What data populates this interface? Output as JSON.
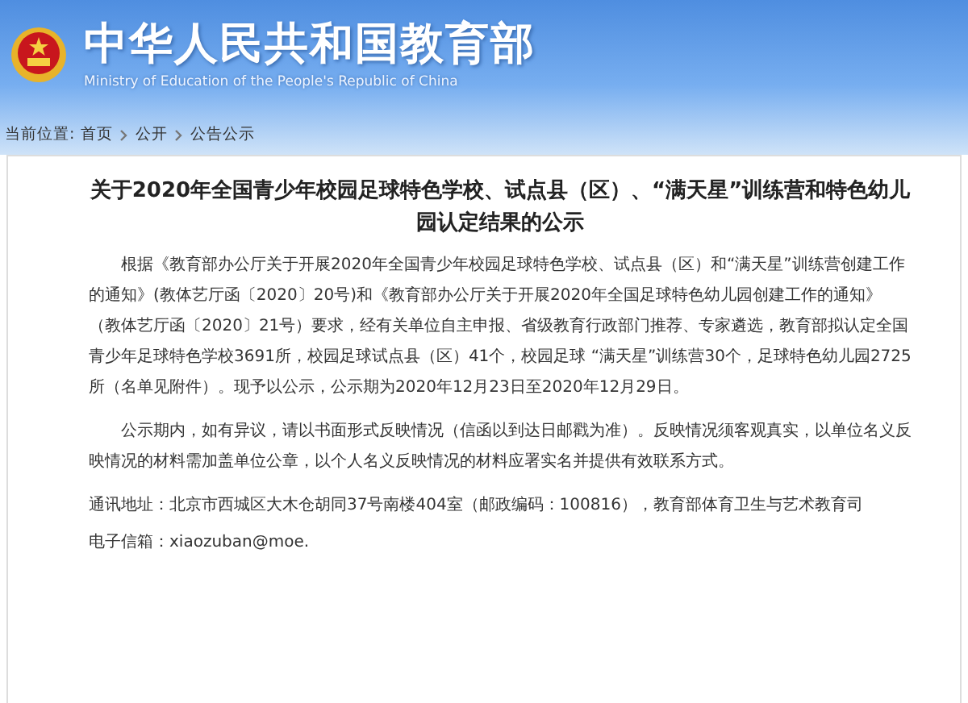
{
  "header": {
    "title": "中华人民共和国教育部",
    "subtitle": "Ministry of Education of the People's Republic of China"
  },
  "breadcrumb": {
    "label": "当前位置:",
    "items": [
      "首页",
      "公开",
      "公告公示"
    ]
  },
  "article": {
    "title": "关于2020年全国青少年校园足球特色学校、试点县（区）、“满天星”训练营和特色幼儿园认定结果的公示",
    "paragraphs": [
      "根据《教育部办公厅关于开展2020年全国青少年校园足球特色学校、试点县（区）和“满天星”训练营创建工作的通知》(教体艺厅函〔2020〕20号)和《教育部办公厅关于开展2020年全国足球特色幼儿园创建工作的通知》（教体艺厅函〔2020〕21号）要求，经有关单位自主申报、省级教育行政部门推荐、专家遴选，教育部拟认定全国青少年足球特色学校3691所，校园足球试点县（区）41个，校园足球 “满天星”训练营30个，足球特色幼儿园2725所（名单见附件）。现予以公示，公示期为2020年12月23日至2020年12月29日。",
      "公示期内，如有异议，请以书面形式反映情况（信函以到达日邮戳为准）。反映情况须客观真实，以单位名义反映情况的材料需加盖单位公章，以个人名义反映情况的材料应署实名并提供有效联系方式。"
    ],
    "contacts": [
      "通讯地址：北京市西城区大木仓胡同37号南楼404室（邮政编码：100816），教育部体育卫生与艺术教育司",
      "电子信箱：xiaozuban@moe."
    ]
  }
}
